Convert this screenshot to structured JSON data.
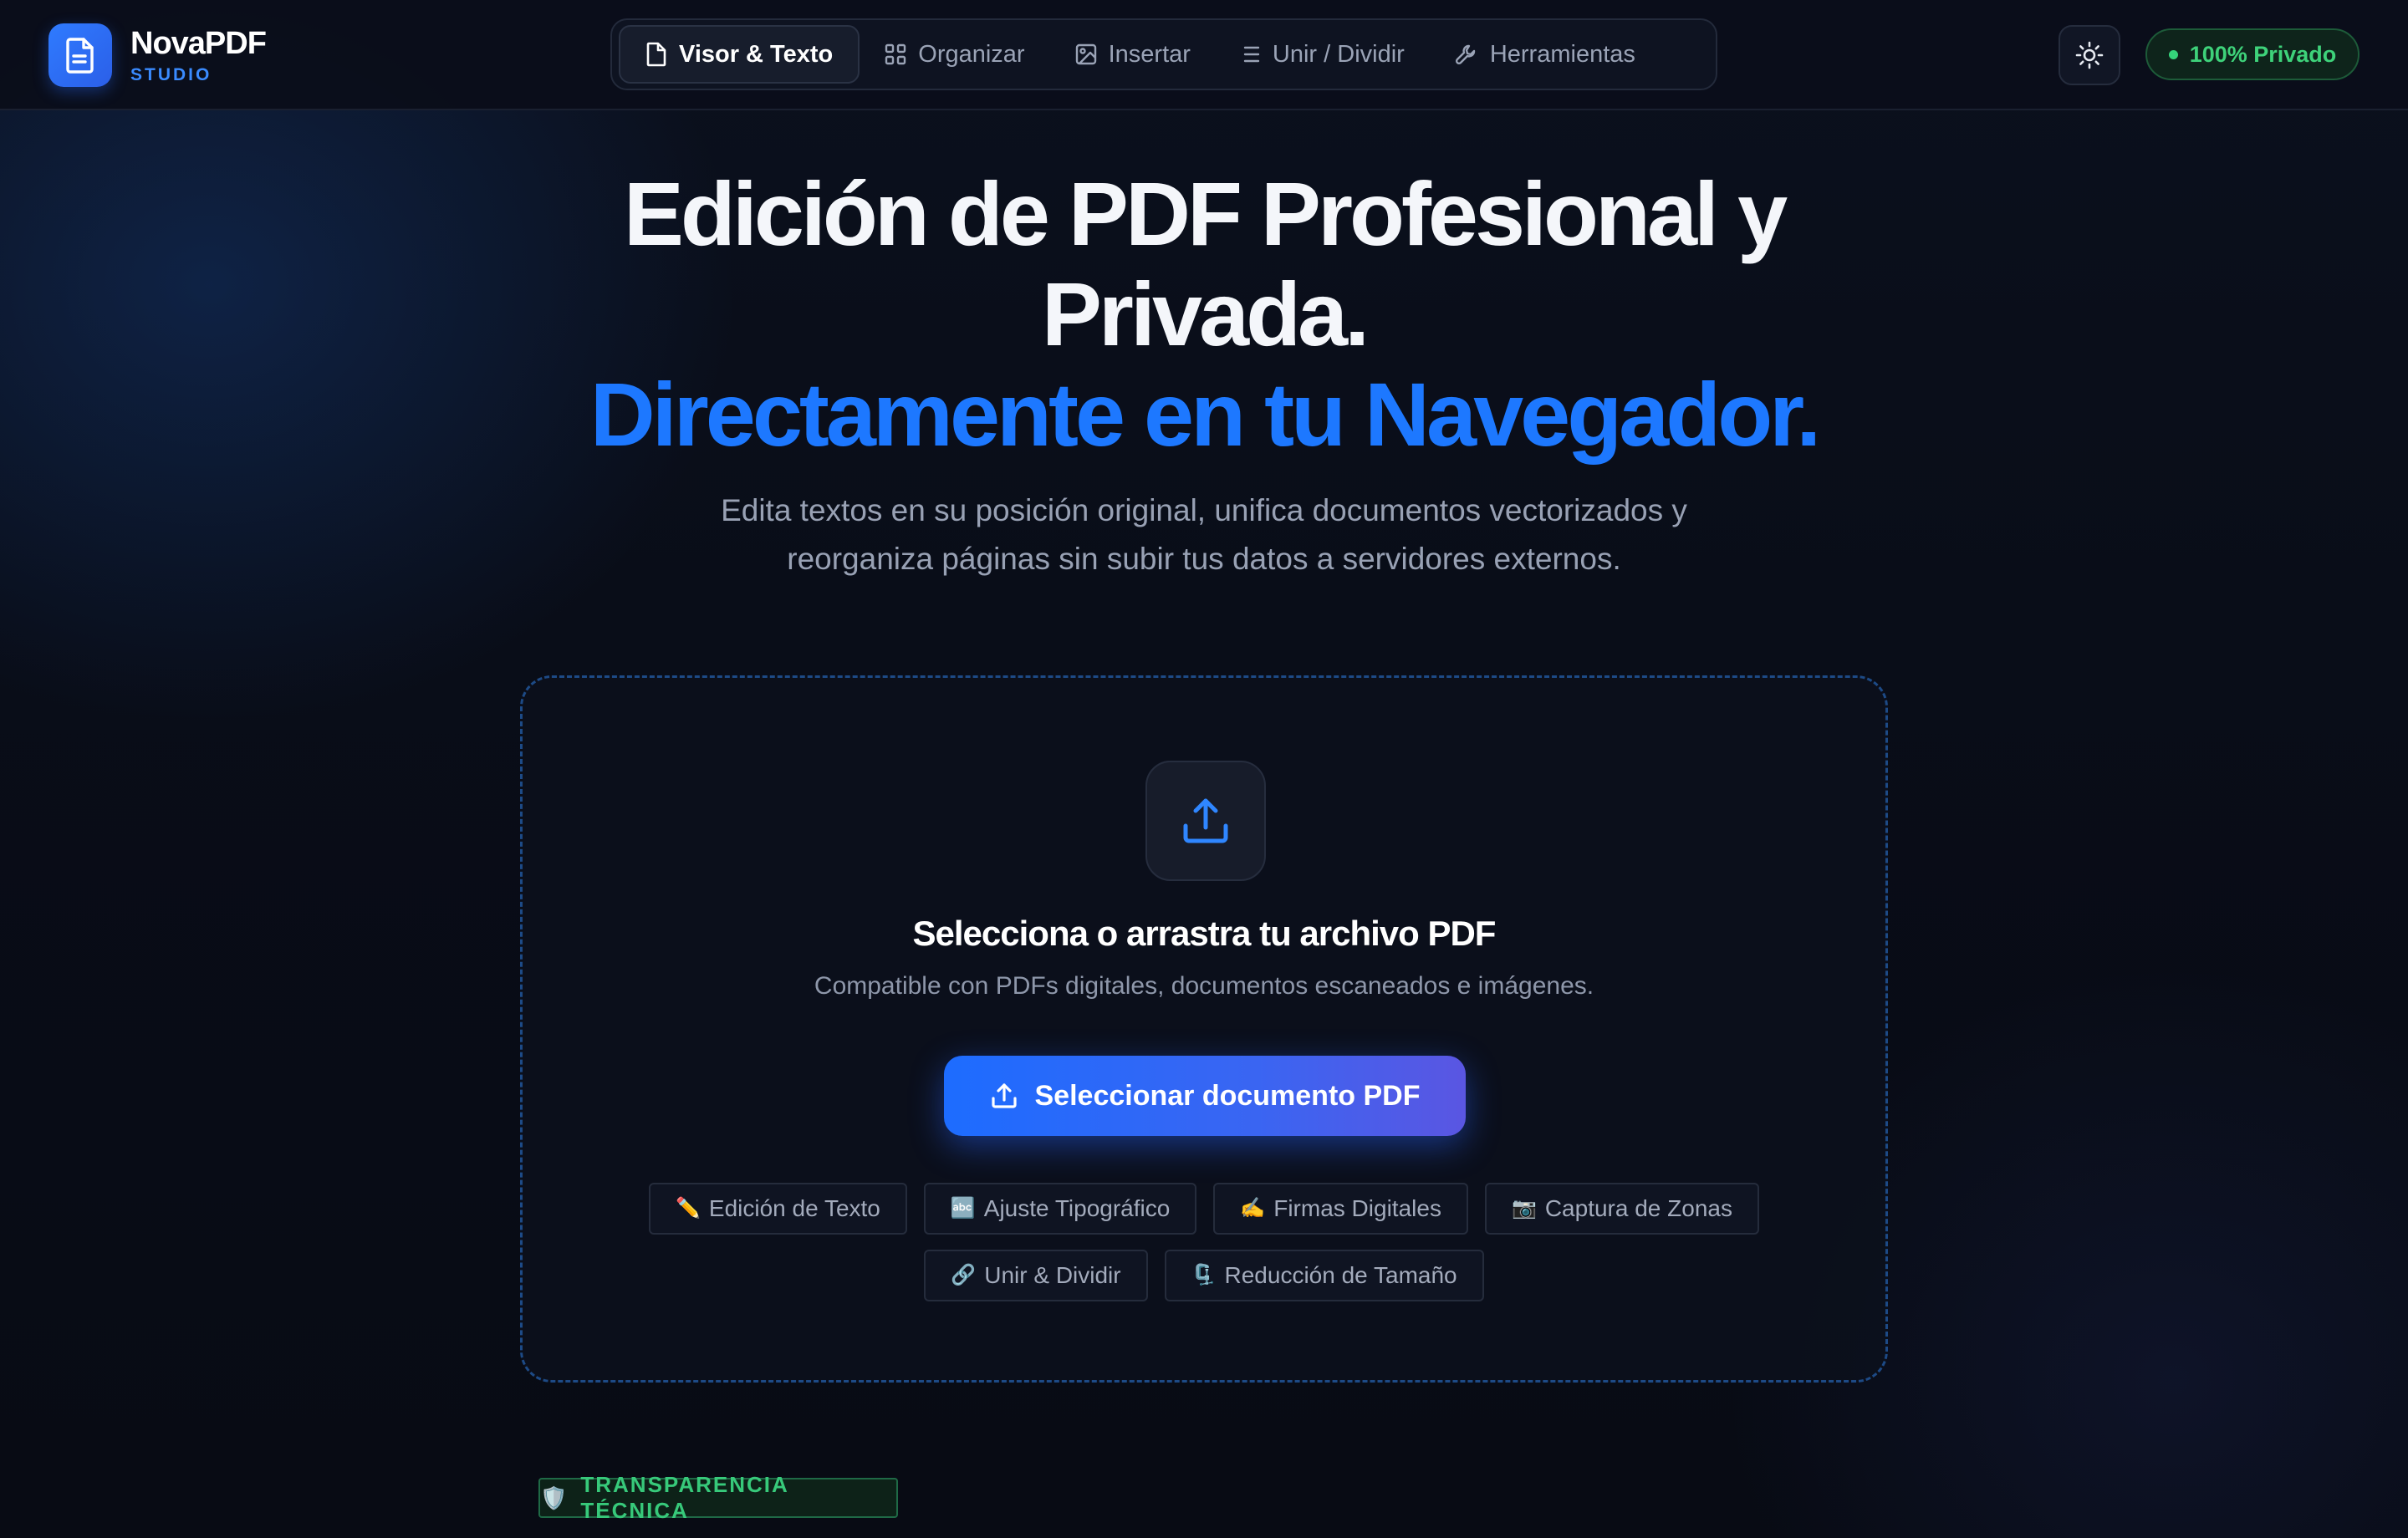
{
  "brand": {
    "name": "NovaPDF",
    "subtitle": "STUDIO",
    "logo_icon": "document-icon"
  },
  "nav": {
    "tabs": [
      {
        "label": "Visor & Texto",
        "icon": "file-icon",
        "active": true
      },
      {
        "label": "Organizar",
        "icon": "grid-icon",
        "active": false
      },
      {
        "label": "Insertar",
        "icon": "image-icon",
        "active": false
      },
      {
        "label": "Unir / Dividir",
        "icon": "list-icon",
        "active": false
      },
      {
        "label": "Herramientas",
        "icon": "wrench-icon",
        "active": false
      }
    ]
  },
  "header": {
    "theme_toggle_icon": "sun-icon",
    "privacy_badge": "100% Privado"
  },
  "hero": {
    "title": "Edición de PDF Profesional y Privada.",
    "title_accent": "Directamente en tu Navegador.",
    "subtitle": "Edita textos en su posición original, unifica documentos vectorizados y reorganiza páginas sin subir tus datos a servidores externos."
  },
  "dropzone": {
    "upload_icon": "upload-icon",
    "title": "Selecciona o arrastra tu archivo PDF",
    "subtitle": "Compatible con PDFs digitales, documentos escaneados e imágenes.",
    "button_label": "Seleccionar documento PDF",
    "features": [
      {
        "icon": "✏️",
        "label": "Edición de Texto"
      },
      {
        "icon": "🔤",
        "label": "Ajuste Tipográfico"
      },
      {
        "icon": "✍️",
        "label": "Firmas Digitales"
      },
      {
        "icon": "📷",
        "label": "Captura de Zonas"
      },
      {
        "icon": "🔗",
        "label": "Unir & Dividir"
      },
      {
        "icon": "🗜️",
        "label": "Reducción de Tamaño"
      }
    ]
  },
  "transparency": {
    "icon": "🛡️",
    "label": "TRANSPARENCIA TÉCNICA"
  },
  "colors": {
    "accent": "#1d78ff",
    "success": "#3ed27a",
    "background": "#0a0e1a"
  }
}
